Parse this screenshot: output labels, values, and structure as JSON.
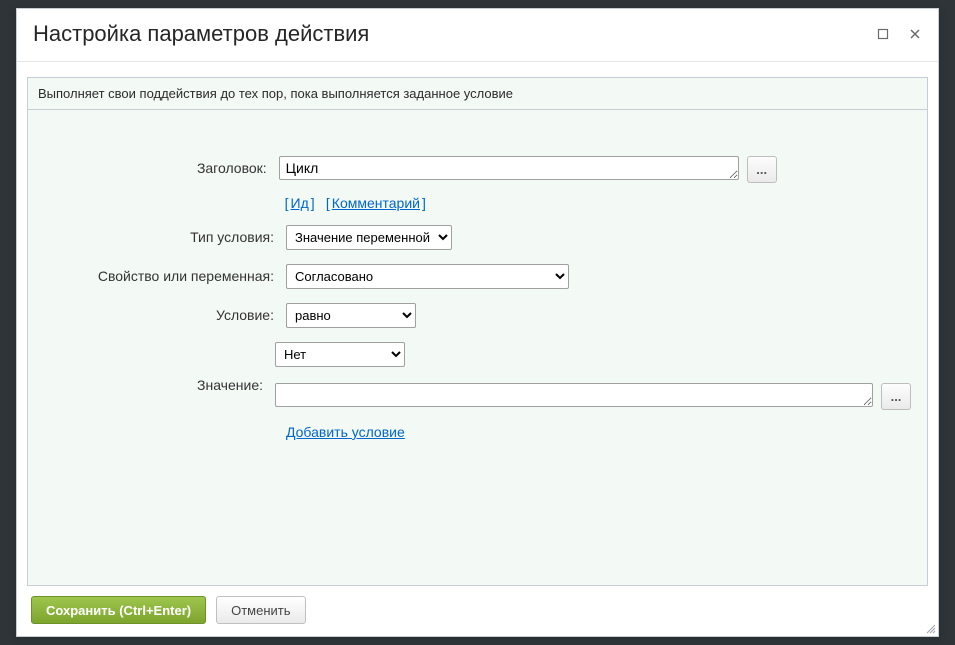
{
  "dialog": {
    "title": "Настройка параметров действия",
    "description": "Выполняет свои поддействия до тех пор, пока выполняется заданное условие"
  },
  "form": {
    "title_label": "Заголовок:",
    "title_value": "Цикл",
    "ellipsis": "...",
    "link_id": "Ид",
    "link_comment": "Комментарий",
    "type_label": "Тип условия:",
    "type_value": "Значение переменной",
    "var_label": "Свойство или переменная:",
    "var_value": "Согласовано",
    "cond_label": "Условие:",
    "cond_value": "равно",
    "value_label": "Значение:",
    "bool_value": "Нет",
    "text_value": "",
    "add_condition": "Добавить условие"
  },
  "footer": {
    "save": "Сохранить (Ctrl+Enter)",
    "cancel": "Отменить"
  }
}
